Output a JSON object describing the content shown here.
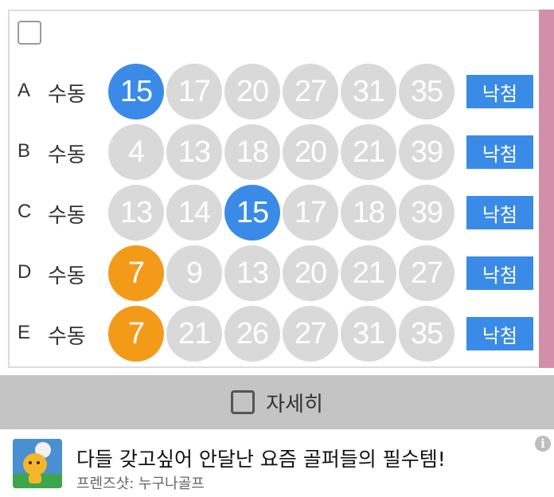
{
  "rows": [
    {
      "letter": "A",
      "mode": "수동",
      "numbers": [
        "15",
        "17",
        "20",
        "27",
        "31",
        "35"
      ],
      "highlight": [
        "blue",
        "",
        "",
        "",
        "",
        ""
      ],
      "button": "낙첨"
    },
    {
      "letter": "B",
      "mode": "수동",
      "numbers": [
        "4",
        "13",
        "18",
        "20",
        "21",
        "39"
      ],
      "highlight": [
        "",
        "",
        "",
        "",
        "",
        ""
      ],
      "button": "낙첨"
    },
    {
      "letter": "C",
      "mode": "수동",
      "numbers": [
        "13",
        "14",
        "15",
        "17",
        "18",
        "39"
      ],
      "highlight": [
        "",
        "",
        "blue",
        "",
        "",
        ""
      ],
      "button": "낙첨"
    },
    {
      "letter": "D",
      "mode": "수동",
      "numbers": [
        "7",
        "9",
        "13",
        "20",
        "21",
        "27"
      ],
      "highlight": [
        "orange",
        "",
        "",
        "",
        "",
        ""
      ],
      "button": "낙첨"
    },
    {
      "letter": "E",
      "mode": "수동",
      "numbers": [
        "7",
        "21",
        "26",
        "27",
        "31",
        "35"
      ],
      "highlight": [
        "orange",
        "",
        "",
        "",
        "",
        ""
      ],
      "button": "낙첨"
    }
  ],
  "detail": {
    "label": "자세히"
  },
  "ad": {
    "title": "다들 갖고싶어 안달난 요즘 골퍼들의 필수템!",
    "subtitle": "프렌즈샷: 누구나골프",
    "info_icon": "i"
  },
  "colors": {
    "blue": "#3a8be8",
    "orange": "#f49a19",
    "gray": "#d9d9d9",
    "accent_bar": "#d28fa7"
  }
}
